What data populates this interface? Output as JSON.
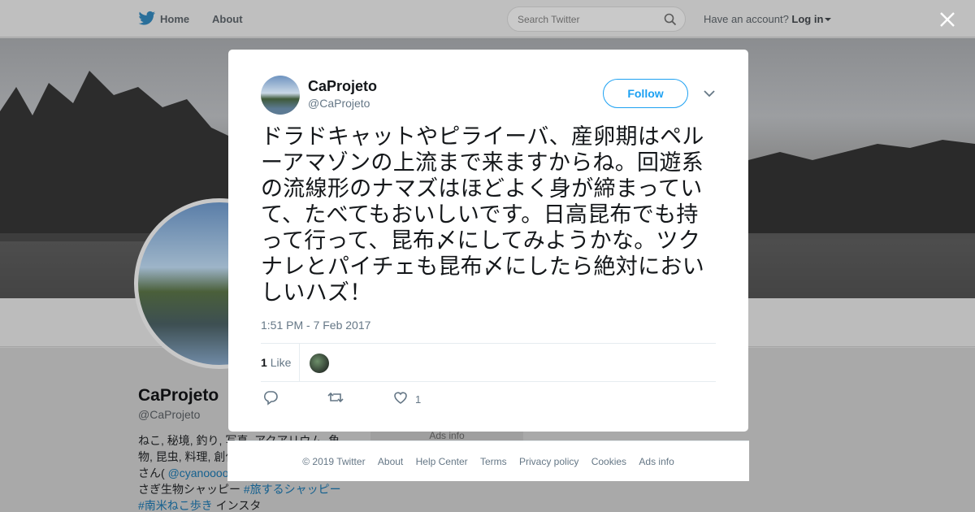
{
  "nav": {
    "home_label": "Home",
    "about_label": "About",
    "search_placeholder": "Search Twitter",
    "have_account_label": "Have an account?",
    "login_label": "Log in"
  },
  "profile": {
    "name": "CaProjeto",
    "handle": "@CaProjeto",
    "bio_line1": "ねこ, 秘境, 釣り, 写真, アクアリウム, 魚",
    "bio_line2": "物, 昆虫, 料理, 創作",
    "bio_line3_prefix": "さん(",
    "bio_mention": "@cyanoooo",
    "bio_line4_prefix": "さぎ生物シャッピー ",
    "bio_tag1": "#旅するシャッピー",
    "bio_tag2": "#南米ねこ歩き",
    "bio_line5_suffix": " インスタ",
    "ads_info": "Ads info"
  },
  "tweet": {
    "author_name": "CaProjeto",
    "author_handle": "@CaProjeto",
    "follow_label": "Follow",
    "text": "ドラドキャットやピライーバ、産卵期はペルーアマゾンの上流まで来ますからね。回遊系の流線形のナマズはほどよく身が締まっていて、たべてもおいしいです。日高昆布でも持って行って、昆布〆にしてみようかな。ツクナレとパイチェも昆布〆にしたら絶対においしいハズ！",
    "timestamp": "1:51 PM - 7 Feb 2017",
    "likes_count": "1",
    "likes_label": "Like",
    "like_action_count": "1"
  },
  "footer": {
    "copyright": "© 2019 Twitter",
    "about": "About",
    "help_center": "Help Center",
    "terms": "Terms",
    "privacy": "Privacy policy",
    "cookies": "Cookies",
    "ads_info": "Ads info"
  },
  "colors": {
    "accent": "#1da1f2",
    "text_primary": "#14171a",
    "text_secondary": "#657786"
  }
}
